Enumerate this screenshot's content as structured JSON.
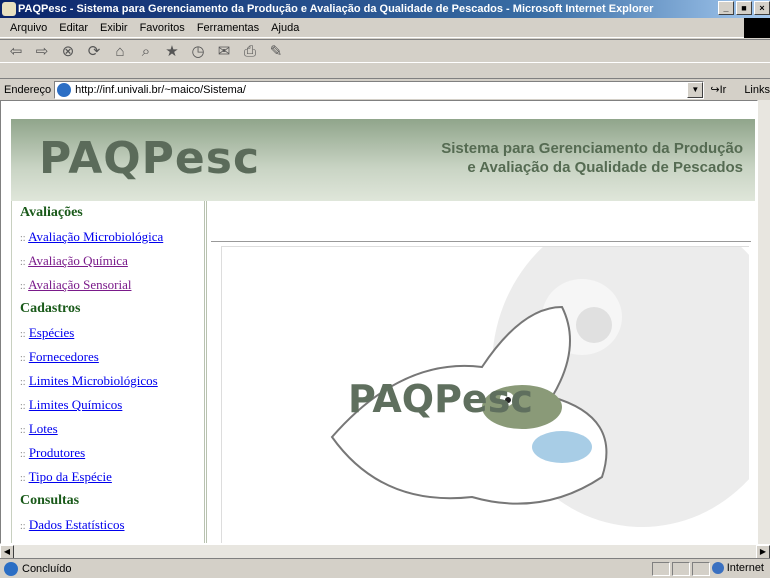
{
  "window": {
    "title": "PAQPesc - Sistema para Gerenciamento da Produção e Avaliação da Qualidade de Pescados - Microsoft Internet Explorer",
    "controls": [
      "_",
      "■",
      "×"
    ]
  },
  "menu": [
    "Arquivo",
    "Editar",
    "Exibir",
    "Favoritos",
    "Ferramentas",
    "Ajuda"
  ],
  "toolbar_icons": [
    "back-icon",
    "forward-icon",
    "stop-icon",
    "refresh-icon",
    "home-icon",
    "search-icon",
    "favorites-icon",
    "history-icon",
    "mail-icon",
    "print-icon",
    "edit-icon"
  ],
  "address": {
    "label": "Endereço",
    "url": "http://inf.univali.br/~maico/Sistema/",
    "go": "Ir",
    "links": "Links"
  },
  "banner": {
    "brand": "PAQPesc",
    "tagline_line1": "Sistema para Gerenciamento da Produção",
    "tagline_line2": "e Avaliação da Qualidade de Pescados"
  },
  "sidebar": {
    "sections": [
      {
        "title": "Avaliações",
        "items": [
          {
            "label": "Avaliação Microbiológica",
            "visited": false
          },
          {
            "label": "Avaliação Química",
            "visited": true
          },
          {
            "label": "Avaliação Sensorial",
            "visited": true
          }
        ]
      },
      {
        "title": "Cadastros",
        "items": [
          {
            "label": "Espécies",
            "visited": false
          },
          {
            "label": "Fornecedores",
            "visited": false
          },
          {
            "label": "Limites Microbiológicos",
            "visited": false
          },
          {
            "label": "Limites Químicos",
            "visited": false
          },
          {
            "label": "Lotes",
            "visited": false
          },
          {
            "label": "Produtores",
            "visited": false
          },
          {
            "label": "Tipo da Espécie",
            "visited": false
          }
        ]
      },
      {
        "title": "Consultas",
        "items": [
          {
            "label": "Dados Estatísticos",
            "visited": false
          }
        ]
      }
    ]
  },
  "main": {
    "logo_text": "PAQPesc"
  },
  "status": {
    "text": "Concluído",
    "zone": "Internet"
  }
}
